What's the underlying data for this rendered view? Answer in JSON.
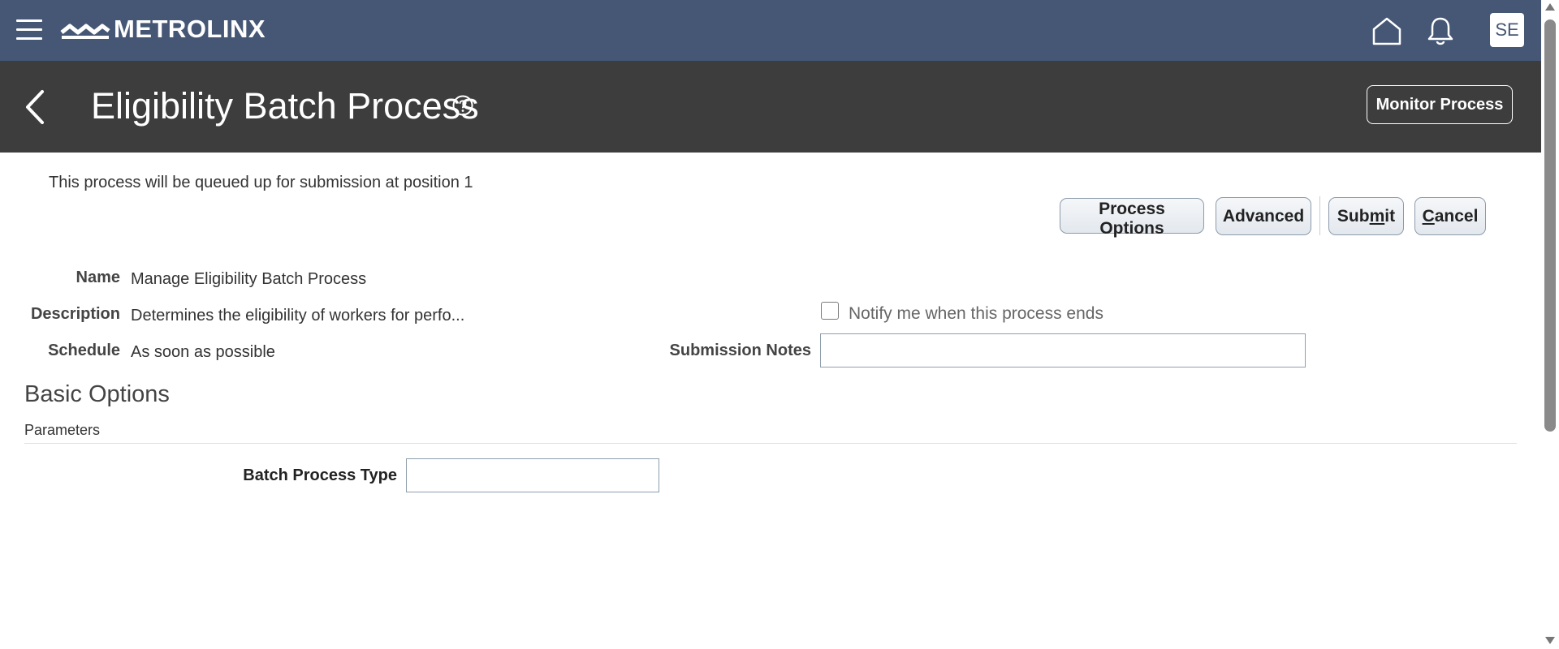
{
  "header": {
    "brand": "METROLINX",
    "avatar_initials": "SE",
    "icons": [
      "hamburger-menu-icon",
      "home-icon",
      "bell-icon"
    ]
  },
  "titlebar": {
    "title": "Eligibility Batch Process",
    "monitor_label": "Monitor Process",
    "icons": [
      "back-icon",
      "help-icon"
    ]
  },
  "form": {
    "queue_message": "This process will be queued up for submission at position 1",
    "buttons": {
      "process_options": "Process Options",
      "advanced": "Advanced",
      "submit": {
        "before": "Sub",
        "access_key": "m",
        "after": "it"
      },
      "cancel": {
        "before": "",
        "access_key": "C",
        "after": "ancel"
      }
    },
    "fields": {
      "name_label": "Name",
      "name_value": "Manage Eligibility Batch Process",
      "description_label": "Description",
      "description_value": "Determines the eligibility of workers for perfo...",
      "schedule_label": "Schedule",
      "schedule_value": "As soon as possible",
      "notify_label": "Notify me when this process ends",
      "notify_checked": false,
      "notes_label": "Submission Notes",
      "notes_value": ""
    }
  },
  "basic_options": {
    "title": "Basic Options",
    "subtitle": "Parameters",
    "batch_type_label": "Batch Process Type",
    "batch_type_value": ""
  },
  "colors": {
    "topbar": "#455775",
    "titlebar": "#3d3d3d",
    "button_border": "#8c9bab"
  }
}
